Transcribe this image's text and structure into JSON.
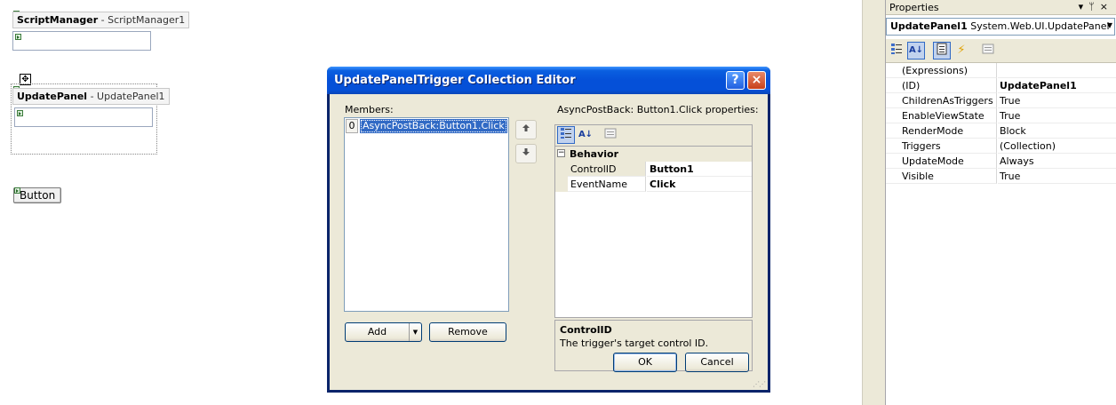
{
  "designer": {
    "script_manager": {
      "type": "ScriptManager",
      "id": "ScriptManager1"
    },
    "update_panel": {
      "type": "UpdatePanel",
      "id": "UpdatePanel1"
    },
    "button_text": "Button"
  },
  "properties_pane": {
    "title": "Properties",
    "title_buttons": [
      "▾",
      "ᛘ",
      "×"
    ],
    "object_name": "UpdatePanel1",
    "object_type": "System.Web.UI.UpdatePanel",
    "rows": [
      {
        "name": "(Expressions)",
        "value": ""
      },
      {
        "name": "(ID)",
        "value": "UpdatePanel1"
      },
      {
        "name": "ChildrenAsTriggers",
        "value": "True"
      },
      {
        "name": "EnableViewState",
        "value": "True"
      },
      {
        "name": "RenderMode",
        "value": "Block"
      },
      {
        "name": "Triggers",
        "value": "(Collection)"
      },
      {
        "name": "UpdateMode",
        "value": "Always"
      },
      {
        "name": "Visible",
        "value": "True"
      }
    ]
  },
  "dialog": {
    "title": "UpdatePanelTrigger Collection Editor",
    "help_glyph": "?",
    "close_glyph": "×",
    "members_label": "Members:",
    "members": [
      {
        "index": "0",
        "text": "AsyncPostBack:Button1.Click"
      }
    ],
    "move_up_glyph": "🡅",
    "move_down_glyph": "🡇",
    "add_label": "Add",
    "remove_label": "Remove",
    "properties_label": "AsyncPostBack: Button1.Click properties:",
    "category": "Behavior",
    "grid_rows": [
      {
        "name": "ControlID",
        "value": "Button1"
      },
      {
        "name": "EventName",
        "value": "Click"
      }
    ],
    "description_title": "ControlID",
    "description_text": "The trigger's target control ID.",
    "ok_label": "OK",
    "cancel_label": "Cancel"
  }
}
